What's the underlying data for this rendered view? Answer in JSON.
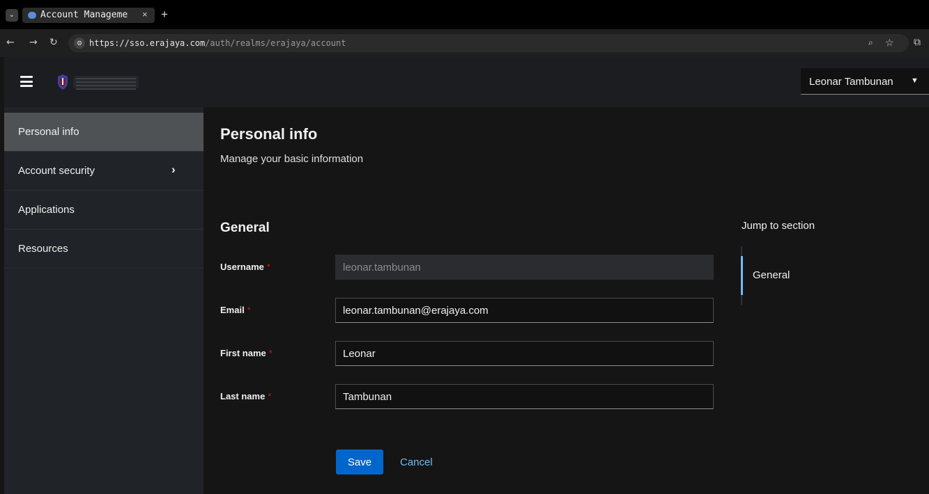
{
  "browser": {
    "tab_menu_icon": "chevron-down-icon",
    "tab_title": "Account Manageme",
    "tab_close": "×",
    "new_tab": "+",
    "url_host": "https://sso.erajaya.com",
    "url_path": "/auth/realms/erajaya/account",
    "nav_icons": [
      "back-arrow-icon",
      "forward-arrow-icon",
      "reload-icon"
    ]
  },
  "header": {
    "user_name": "Leonar Tambunan"
  },
  "sidebar": {
    "items": [
      {
        "label": "Personal info",
        "active": true
      },
      {
        "label": "Account security",
        "expandable": true
      },
      {
        "label": "Applications"
      },
      {
        "label": "Resources"
      }
    ]
  },
  "main": {
    "title": "Personal info",
    "subtitle": "Manage your basic information",
    "section_title": "General",
    "fields": [
      {
        "label": "Username",
        "value": "leonar.tambunan",
        "readonly": true
      },
      {
        "label": "Email",
        "value": "leonar.tambunan@erajaya.com"
      },
      {
        "label": "First name",
        "value": "Leonar"
      },
      {
        "label": "Last name",
        "value": "Tambunan"
      }
    ],
    "required_mark": "*",
    "save_label": "Save",
    "cancel_label": "Cancel"
  },
  "jump": {
    "title": "Jump to section",
    "links": [
      "General"
    ]
  },
  "colors": {
    "accent": "#0066cc",
    "link": "#73bcf7",
    "required": "#c9190b"
  }
}
